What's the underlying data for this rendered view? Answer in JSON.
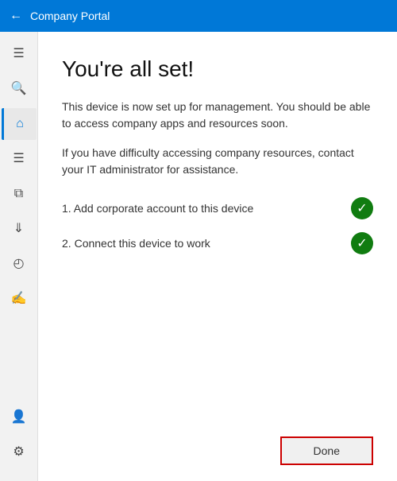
{
  "titleBar": {
    "title": "Company Portal",
    "backLabel": "←"
  },
  "sidebar": {
    "items": [
      {
        "id": "menu",
        "icon": "☰",
        "label": "Menu",
        "active": false
      },
      {
        "id": "search",
        "icon": "🔍",
        "label": "Search",
        "active": false
      },
      {
        "id": "home",
        "icon": "⌂",
        "label": "Home",
        "active": true
      },
      {
        "id": "list",
        "icon": "≡",
        "label": "Apps",
        "active": false
      },
      {
        "id": "grid",
        "icon": "▦",
        "label": "Categories",
        "active": false
      },
      {
        "id": "download",
        "icon": "↓",
        "label": "Downloads",
        "active": false
      },
      {
        "id": "device",
        "icon": "☐",
        "label": "Devices",
        "active": false
      },
      {
        "id": "feedback",
        "icon": "💬",
        "label": "Feedback",
        "active": false
      }
    ],
    "bottomItems": [
      {
        "id": "user",
        "icon": "👤",
        "label": "Account",
        "active": false
      },
      {
        "id": "settings",
        "icon": "⚙",
        "label": "Settings",
        "active": false
      }
    ]
  },
  "content": {
    "title": "You're all set!",
    "description1": "This device is now set up for management.  You should be able to access company apps and resources soon.",
    "description2": "If you have difficulty accessing company resources, contact your IT administrator for assistance.",
    "steps": [
      {
        "number": "1",
        "text": "Add corporate account to this device",
        "done": true
      },
      {
        "number": "2",
        "text": "Connect this device to work",
        "done": true
      }
    ],
    "doneButton": "Done"
  }
}
